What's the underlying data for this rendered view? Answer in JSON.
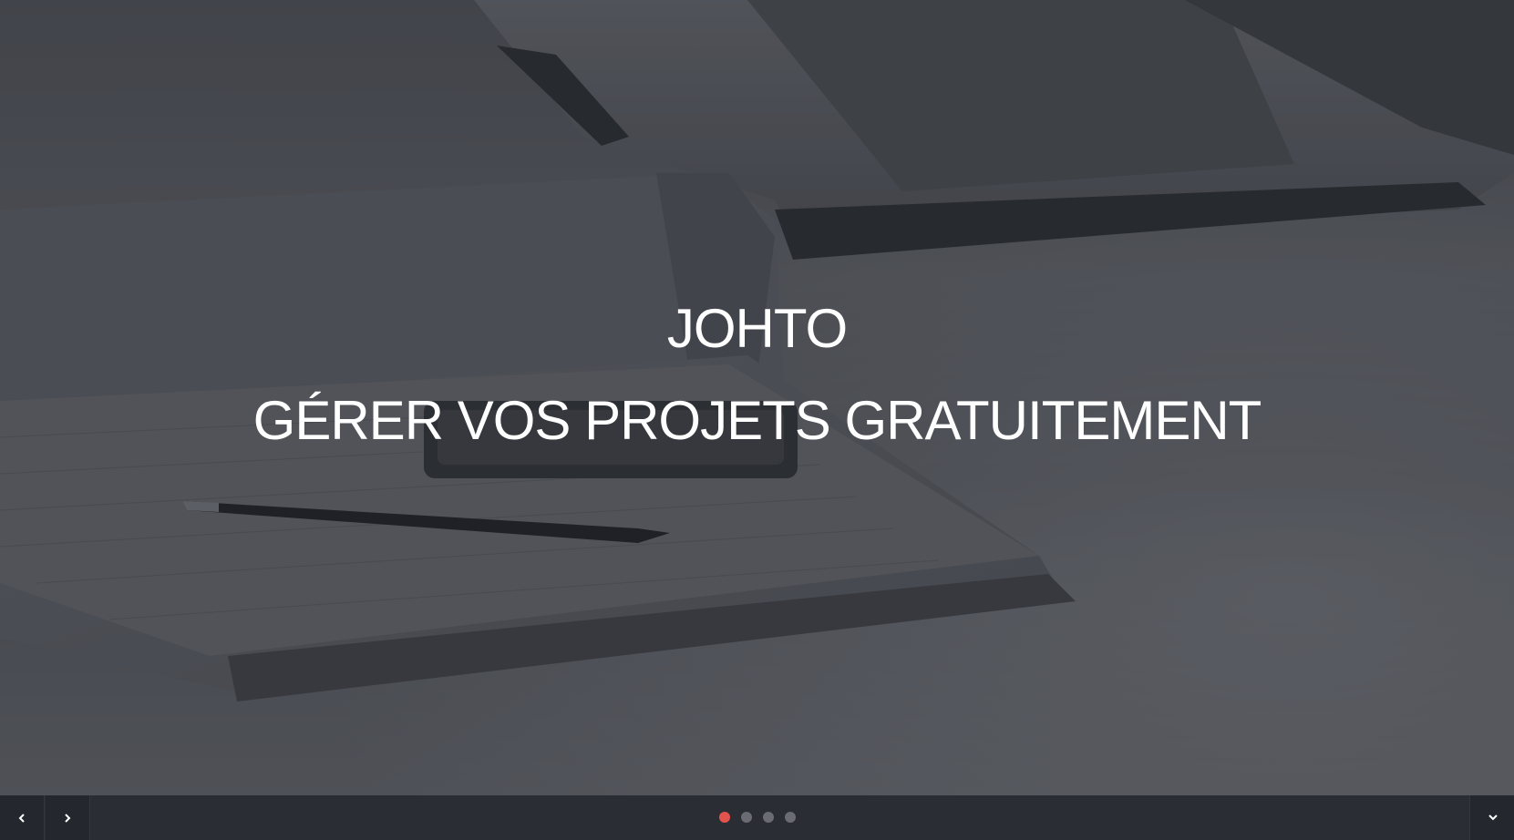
{
  "hero": {
    "title": "JOHTO",
    "subtitle": "GÉRER VOS PROJETS GRATUITEMENT",
    "background_image": "desk-with-notebook-pen-laptop"
  },
  "carousel": {
    "slide_count": 4,
    "active_index": 0,
    "prev_icon": "chevron-left-icon",
    "next_icon": "chevron-right-icon",
    "scroll_down_icon": "chevron-down-icon"
  },
  "colors": {
    "text": "#ffffff",
    "bar_background": "#2b2d35",
    "dot_active": "#e2534e",
    "dot_inactive": "#6a6c72"
  }
}
